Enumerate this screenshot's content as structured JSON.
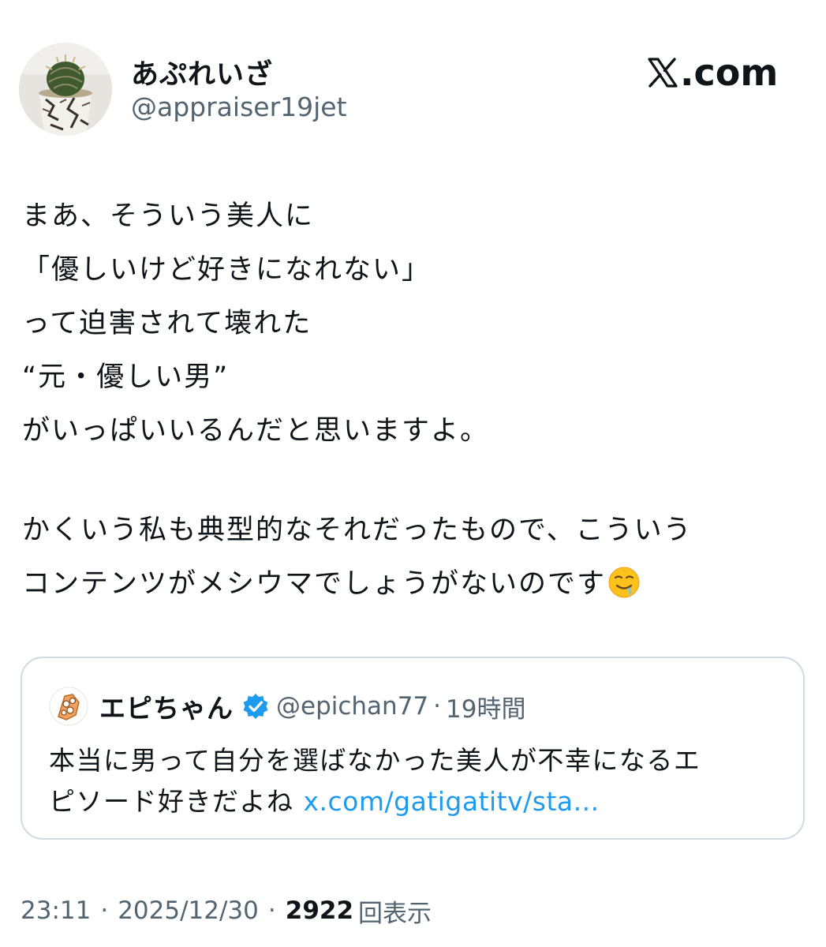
{
  "post": {
    "display_name": "あぷれいざ",
    "handle": "@appraiser19jet",
    "avatar_icon": "cactus-avatar-icon",
    "site_logo_text": ".com",
    "body_lines": [
      "まあ、そういう美人に",
      "「優しいけど好きになれない」",
      "って迫害されて壊れた",
      "“元・優しい男”",
      "がいっぱいいるんだと思いますよ。",
      "",
      "かくいう私も典型的なそれだったもので、こういう",
      "コンテンツがメシウマでしょうがないのです"
    ],
    "emoji_icon": "drooling-face-icon"
  },
  "quote": {
    "display_name": "エピちゃん",
    "verified_icon": "verified-badge-icon",
    "handle": "@epichan77",
    "separator": "·",
    "time": "19時間",
    "text_lines": [
      "本当に男って自分を選ばなかった美人が不幸になるエ",
      "ピソード好きだよね "
    ],
    "link": "x.com/gatigatitv/sta..."
  },
  "meta": {
    "time": "23:11",
    "separator": "·",
    "date": "2025/12/30",
    "views_count": "2922",
    "views_label": "回表示"
  },
  "colors": {
    "text": "#0f1419",
    "secondary": "#536471",
    "link": "#1d9bf0",
    "border": "#cfd9de",
    "verified": "#1d9bf0"
  }
}
